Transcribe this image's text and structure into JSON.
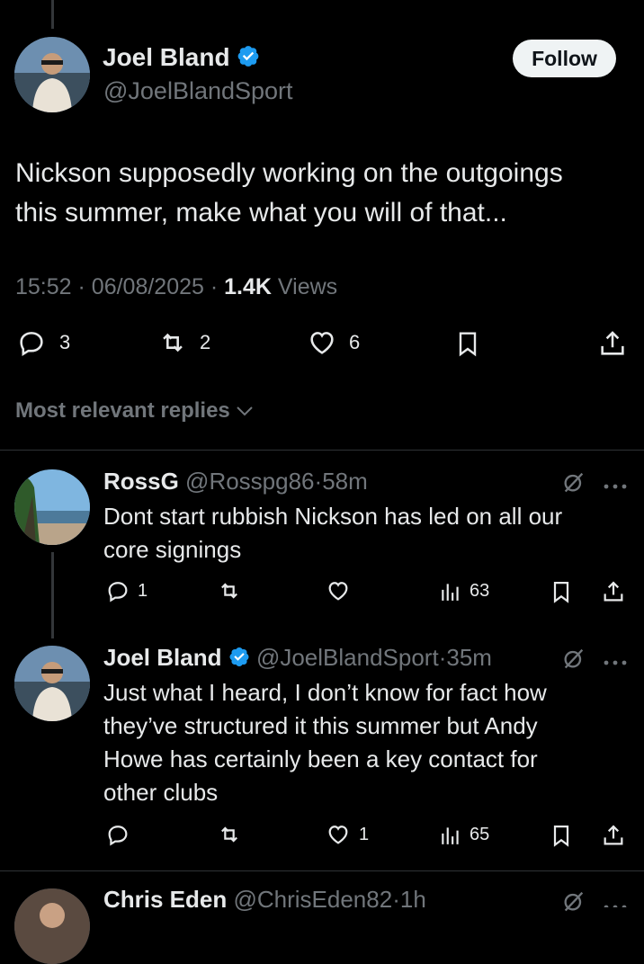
{
  "main_tweet": {
    "author_name": "Joel Bland",
    "author_handle": "@JoelBlandSport",
    "follow_label": "Follow",
    "text_line1": "Nickson supposedly working on the outgoings",
    "text_line2": "this summer, make what you will of that...",
    "time": "15:52",
    "date": "06/08/2025",
    "views_count": "1.4K",
    "views_label": "Views",
    "replies": "3",
    "reposts": "2",
    "likes": "6",
    "icons": [
      "reply-icon",
      "repost-icon",
      "like-icon",
      "bookmark-icon",
      "share-icon"
    ]
  },
  "sort": {
    "label": "Most relevant replies"
  },
  "replies": [
    {
      "name": "RossG",
      "handle": "@Rosspg86",
      "time": "58m",
      "line1": "Dont start rubbish Nickson has led on all our",
      "line2": "core signings",
      "reply_count": "1",
      "repost_count": "",
      "like_count": "",
      "views": "63"
    },
    {
      "name": "Joel Bland",
      "handle": "@JoelBlandSport",
      "time": "35m",
      "line1": "Just what I heard, I don’t know for fact how",
      "line2": "they’ve structured it this summer but Andy",
      "line3": "Howe has certainly been a key contact for",
      "line4": "other clubs",
      "reply_count": "",
      "repost_count": "",
      "like_count": "1",
      "views": "65"
    },
    {
      "name": "Chris Eden",
      "handle": "@ChrisEden82",
      "time": "1h"
    }
  ],
  "separator": "·",
  "colors": {
    "background": "#000000",
    "text": "#e7e9ea",
    "muted": "#71767b",
    "verified": "#1d9bf0",
    "divider": "#2f3336"
  }
}
